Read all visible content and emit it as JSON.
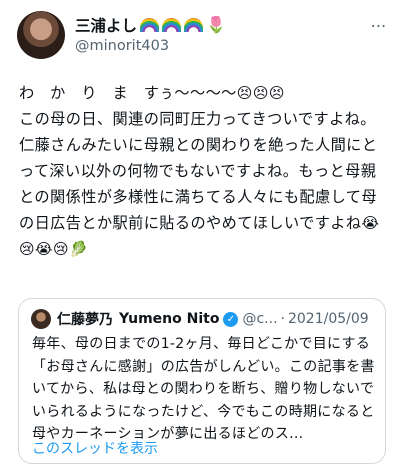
{
  "author": {
    "display_name": "三浦よし",
    "handle": "@minorit403",
    "name_emoji": [
      "rainbow",
      "rainbow",
      "rainbow",
      "tulip"
    ]
  },
  "more_icon": "⋯",
  "tweet": {
    "line1": "わ　か　り　ま　すぅ〜〜〜〜",
    "line1_emoji": [
      "😣",
      "😣",
      "😣"
    ],
    "body": "この母の日、関連の同町圧力ってきついですよね。仁藤さんみたいに母親との関わりを絶った人間にとって深い以外の何物でもないですよね。もっと母親との関係性が多様性に満ちてる人々にも配慮して母の日広告とか駅前に貼るのやめてほしいですよね",
    "body_emoji": [
      "😭",
      "😢",
      "😭",
      "😢",
      "🥬"
    ]
  },
  "quote": {
    "display_name": "仁藤夢乃",
    "display_name_latin": "Yumeno Nito",
    "verified_icon": "✓",
    "handle": "@c...",
    "separator": "·",
    "date": "2021/05/09",
    "text": "毎年、母の日までの1-2ヶ月、毎日どこかで目にする「お母さんに感謝」の広告がしんどい。この記事を書いてから、私は母との関わりを断ち、贈り物しないでいられるようになったけど、今でもこの時期になると母やカーネーションが夢に出るほどのス...",
    "show_thread": "このスレッドを表示"
  },
  "colors": {
    "text": "#0f1419",
    "secondary": "#536471",
    "link": "#1d9bf0",
    "border": "#cfd9de"
  }
}
